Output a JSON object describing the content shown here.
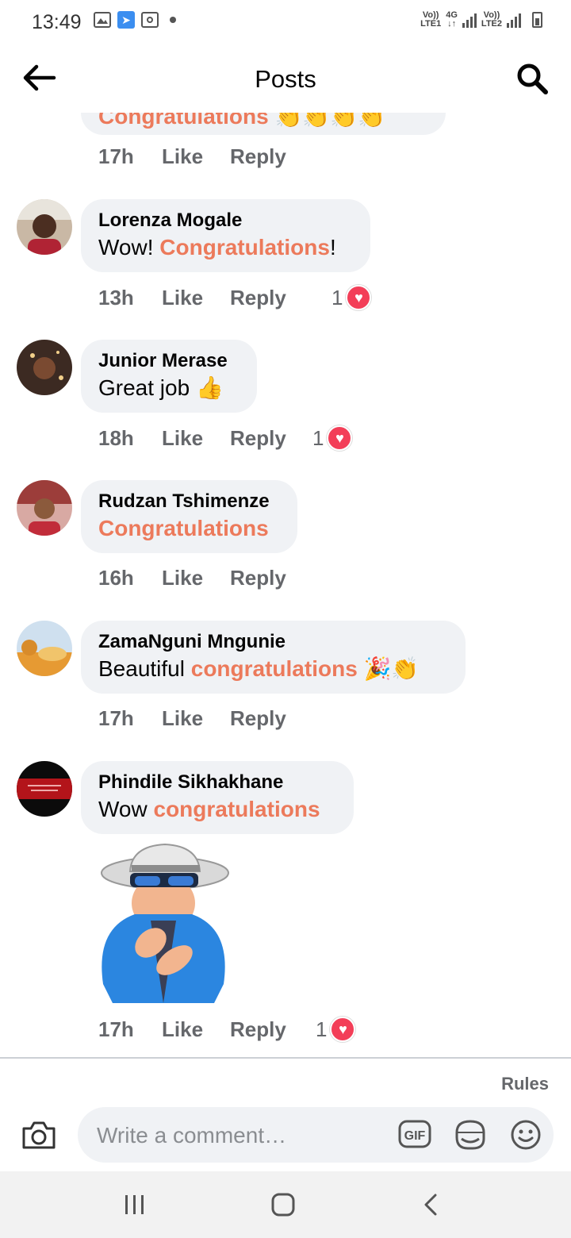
{
  "status_bar": {
    "time": "13:49",
    "net1_top": "Vo))",
    "net1_bottom": "LTE1",
    "net2_top": "4G",
    "net3_top": "Vo))",
    "net3_bottom": "LTE2"
  },
  "header": {
    "title": "Posts"
  },
  "comments": [
    {
      "time": "17h",
      "like": "Like",
      "reply": "Reply"
    },
    {
      "name": "Lorenza Mogale",
      "pre": "Wow! ",
      "highlight": "Congratulations",
      "post": "!",
      "time": "13h",
      "like": "Like",
      "reply": "Reply",
      "reactions": "1"
    },
    {
      "name": "Junior Merase",
      "pre": "Great job ",
      "emoji": "👍",
      "time": "18h",
      "like": "Like",
      "reply": "Reply",
      "reactions": "1"
    },
    {
      "name": "Rudzan Tshimenze",
      "highlight": "Congratulations",
      "time": "16h",
      "like": "Like",
      "reply": "Reply"
    },
    {
      "name": "ZamaNguni Mngunie",
      "pre": "Beautiful ",
      "highlight": "congratulations",
      "emoji": "🎉👏",
      "time": "17h",
      "like": "Like",
      "reply": "Reply"
    },
    {
      "name": "Phindile Sikhakhane",
      "pre": "Wow ",
      "highlight": "congratulations",
      "time": "17h",
      "like": "Like",
      "reply": "Reply",
      "reactions": "1"
    }
  ],
  "partial_comment": {
    "highlight": "Congratulations",
    "emoji": "👏👏👏👏"
  },
  "composer": {
    "rules_label": "Rules",
    "placeholder": "Write a comment…",
    "gif_label": "GIF"
  },
  "colors": {
    "highlight": "#ec7a5b",
    "bubble": "#f0f2f5",
    "meta": "#65676b",
    "heart": "#f33e58"
  }
}
